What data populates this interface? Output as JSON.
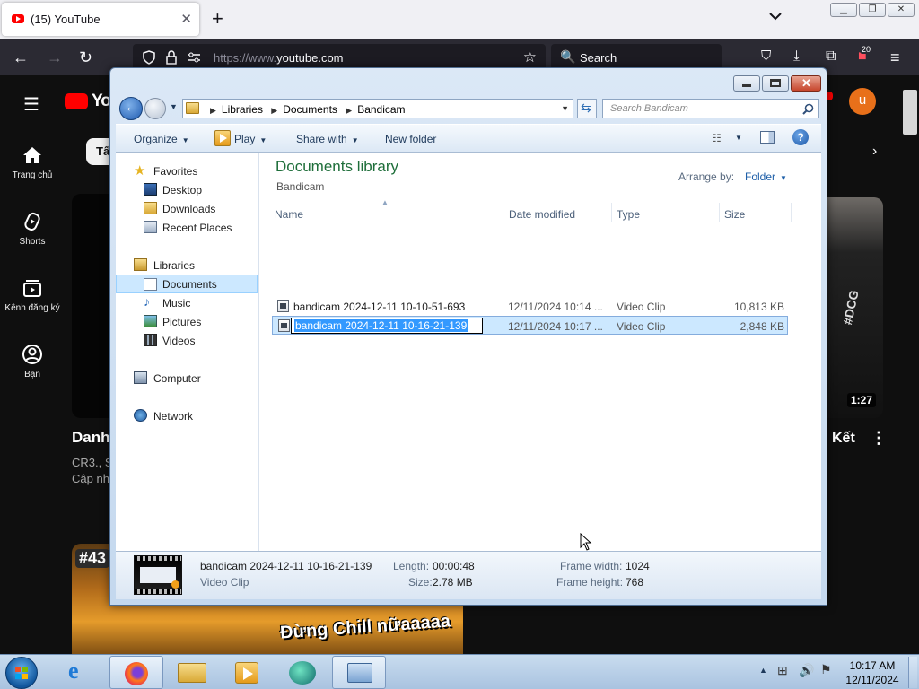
{
  "browser": {
    "tab_title": "(15) YouTube",
    "url_prefix": "https://www.",
    "url_domain": "youtube.com",
    "search_placeholder": "Search",
    "extensions_badge": "20"
  },
  "youtube": {
    "logo_text": "Yo",
    "chip_text": "Tấ",
    "avatar_letter": "u",
    "guide": [
      {
        "label": "Trang chủ",
        "icon": "home-icon"
      },
      {
        "label": "Shorts",
        "icon": "shorts-icon"
      },
      {
        "label": "Kênh đăng ký",
        "icon": "subscriptions-icon"
      },
      {
        "label": "Bạn",
        "icon": "you-icon"
      }
    ],
    "left_video": {
      "title": "Danh",
      "line1": "CR3., S",
      "line2": "Cập nh"
    },
    "right_video": {
      "title": "Kết",
      "duration": "1:27",
      "overlay_text": "#DCG"
    },
    "bottom_thumb": {
      "tag": "#43",
      "text": "Đừng Chill nữaaaaa"
    }
  },
  "explorer": {
    "breadcrumb": [
      "Libraries",
      "Documents",
      "Bandicam"
    ],
    "search_placeholder": "Search Bandicam",
    "commands": {
      "organize": "Organize",
      "play": "Play",
      "share": "Share with",
      "new_folder": "New folder"
    },
    "nav": {
      "favorites": "Favorites",
      "desktop": "Desktop",
      "downloads": "Downloads",
      "recent": "Recent Places",
      "libraries": "Libraries",
      "documents": "Documents",
      "music": "Music",
      "pictures": "Pictures",
      "videos": "Videos",
      "computer": "Computer",
      "network": "Network"
    },
    "library_title": "Documents library",
    "library_subtitle": "Bandicam",
    "arrange_label": "Arrange by:",
    "arrange_value": "Folder",
    "columns": {
      "name": "Name",
      "date": "Date modified",
      "type": "Type",
      "size": "Size"
    },
    "files": [
      {
        "name": "bandicam 2024-12-11 10-10-51-693",
        "date": "12/11/2024 10:14 ...",
        "type": "Video Clip",
        "size": "10,813 KB",
        "selected": false
      },
      {
        "name": "bandicam 2024-12-11 10-16-21-139",
        "date": "12/11/2024 10:17 ...",
        "type": "Video Clip",
        "size": "2,848 KB",
        "selected": true
      }
    ],
    "details": {
      "name": "bandicam 2024-12-11 10-16-21-139",
      "kind": "Video Clip",
      "length_label": "Length:",
      "length_value": "00:00:48",
      "size_label": "Size:",
      "size_value": "2.78 MB",
      "fw_label": "Frame width:",
      "fw_value": "1024",
      "fh_label": "Frame height:",
      "fh_value": "768"
    }
  },
  "taskbar": {
    "time": "10:17 AM",
    "date": "12/11/2024"
  }
}
